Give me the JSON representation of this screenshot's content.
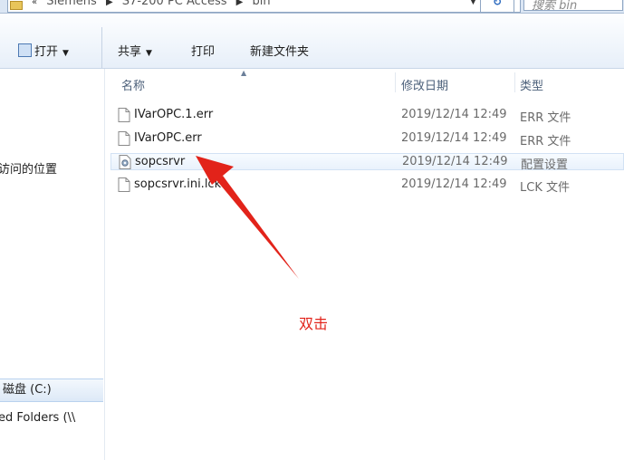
{
  "address": {
    "crumbs": [
      "Siemens",
      "S7-200 PC Access",
      "bin"
    ],
    "search_placeholder": "搜索 bin",
    "refresh_icon": "refresh-icon",
    "dropdown_icon": "chevron-down-icon"
  },
  "toolbar": {
    "open_label": "打开",
    "share_label": "共享",
    "print_label": "打印",
    "new_folder_label": "新建文件夹"
  },
  "nav": {
    "recent_label": "访问的位置",
    "drive_label": "磁盘 (C:)",
    "shared_label": "ed Folders (\\\\"
  },
  "list": {
    "headers": {
      "name": "名称",
      "date": "修改日期",
      "type": "类型"
    },
    "rows": [
      {
        "name": "IVarOPC.1.err",
        "date": "2019/12/14 12:49",
        "type": "ERR 文件",
        "icon": "document-icon"
      },
      {
        "name": "IVarOPC.err",
        "date": "2019/12/14 12:49",
        "type": "ERR 文件",
        "icon": "document-icon"
      },
      {
        "name": "sopcsrvr",
        "date": "2019/12/14 12:49",
        "type": "配置设置",
        "icon": "config-settings-icon"
      },
      {
        "name": "sopcsrvr.ini.lck",
        "date": "2019/12/14 12:49",
        "type": "LCK 文件",
        "icon": "document-icon"
      }
    ]
  },
  "annotation": {
    "text": "双击",
    "color": "#e2231a"
  }
}
